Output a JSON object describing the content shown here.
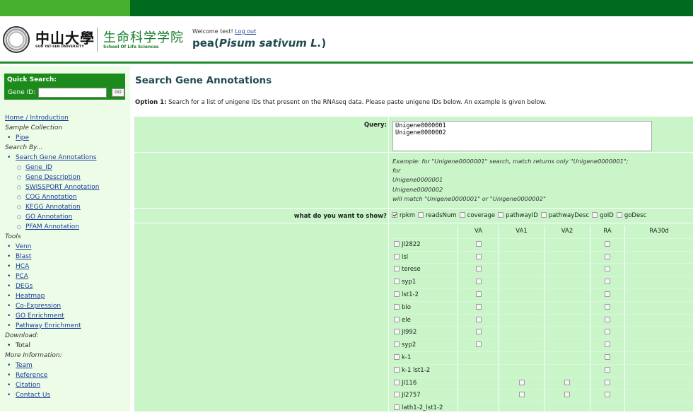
{
  "header": {
    "sysu_cn": "中山大學",
    "sysu_en": "SUN YAT-SEN UNIVERSITY",
    "school_cn": "生命科学学院",
    "school_en": "School Of Life Sciences",
    "welcome_prefix": "Welcome test!",
    "logout": "Log out",
    "title_prefix": "pea(",
    "title_species": "Pisum sativum L.",
    "title_suffix": ")"
  },
  "quick_search": {
    "title": "Quick Search:",
    "label": "Gene ID:",
    "value": "",
    "button": "GO"
  },
  "nav": {
    "home": "Home / Introduction",
    "sample_head": "Sample Collection",
    "pipe": "Pipe",
    "search_head": "Search By...",
    "search_gene": "Search Gene Annotations",
    "gene_id": "Gene_ID",
    "gene_desc": "Gene Description",
    "swissport": "SWISSPORT Annotation",
    "cog": "COG Annotation",
    "kegg": "KEGG Annotation",
    "go": "GO Annotation",
    "pfam": "PFAM Annotation",
    "tools_head": "Tools",
    "venn": "Venn",
    "blast": "Blast",
    "hca": "HCA",
    "pca": "PCA",
    "degs": "DEGs",
    "heatmap": "Heatmap",
    "coexp": "Co-Expression",
    "goenr": "GO Enrichment",
    "pathenr": "Pathway Enrichment",
    "download_head": "Download:",
    "total": "Total",
    "more_head": "More Information:",
    "team": "Team",
    "reference": "Reference",
    "citation": "Citation",
    "contact": "Contact Us"
  },
  "main": {
    "heading": "Search Gene Annotations",
    "option_bold": "Option 1:",
    "option_text": " Search for a list of unigene IDs that present on the RNAseq data. Please paste unigene IDs below. An example is given below.",
    "query_label": "Query:",
    "query_value": "Unigene0000001\nUnigene0000002",
    "example_lines": [
      "Example: for \"Unigene0000001\" search, match returns only \"Unigene0000001\";",
      "for",
      "Unigene0000001",
      "Unigene0000002",
      "will match \"Unigene0000001\" or \"Unigene0000002\""
    ],
    "show_label": "what do you want to show?",
    "show_options": [
      {
        "label": "rpkm",
        "checked": true
      },
      {
        "label": "readsNum",
        "checked": false
      },
      {
        "label": "coverage",
        "checked": false
      },
      {
        "label": "pathwayID",
        "checked": false
      },
      {
        "label": "pathwayDesc",
        "checked": false
      },
      {
        "label": "goID",
        "checked": false
      },
      {
        "label": "goDesc",
        "checked": false
      }
    ],
    "sample_columns": [
      "VA",
      "VA1",
      "VA2",
      "RA",
      "RA30d"
    ],
    "samples": [
      {
        "name": "JI2822",
        "cb": [
          1,
          0,
          0,
          1,
          0
        ]
      },
      {
        "name": "lsl",
        "cb": [
          1,
          0,
          0,
          1,
          0
        ]
      },
      {
        "name": "terese",
        "cb": [
          1,
          0,
          0,
          1,
          0
        ]
      },
      {
        "name": "syp1",
        "cb": [
          1,
          0,
          0,
          1,
          0
        ]
      },
      {
        "name": "lst1-2",
        "cb": [
          1,
          0,
          0,
          1,
          0
        ]
      },
      {
        "name": "bio",
        "cb": [
          1,
          0,
          0,
          1,
          0
        ]
      },
      {
        "name": "ele",
        "cb": [
          1,
          0,
          0,
          1,
          0
        ]
      },
      {
        "name": "JI992",
        "cb": [
          1,
          0,
          0,
          1,
          0
        ]
      },
      {
        "name": "syp2",
        "cb": [
          1,
          0,
          0,
          1,
          0
        ]
      },
      {
        "name": "k-1",
        "cb": [
          0,
          0,
          0,
          1,
          0
        ]
      },
      {
        "name": "k-1 lst1-2",
        "cb": [
          0,
          0,
          0,
          1,
          0
        ]
      },
      {
        "name": "JI116",
        "cb": [
          0,
          1,
          1,
          1,
          0
        ]
      },
      {
        "name": "JI2757",
        "cb": [
          0,
          1,
          1,
          1,
          0
        ]
      },
      {
        "name": "lath1-2_lst1-2",
        "cb": [
          0,
          0,
          0,
          0,
          0
        ]
      }
    ],
    "colors": {
      "frame": "#c9f5c9",
      "dark_green": "#006a1f",
      "sidebar": "#edfce6"
    }
  }
}
